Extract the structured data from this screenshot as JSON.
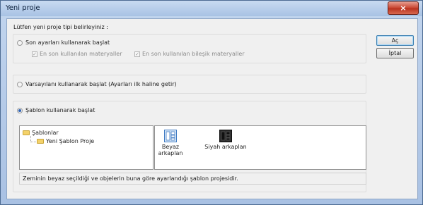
{
  "window": {
    "title": "Yeni proje",
    "close_glyph": "×"
  },
  "prompt": "Lütfen yeni proje tipi belirleyiniz :",
  "option_last": {
    "label": "Son ayarları kullanarak başlat",
    "selected": false,
    "checks": [
      {
        "label": "En son kullanılan materyaller",
        "checked": true,
        "disabled": true
      },
      {
        "label": "En son kullanılan bileşik materyaller",
        "checked": true,
        "disabled": true
      }
    ]
  },
  "option_default": {
    "label": "Varsayılanı kullanarak başlat (Ayarları ilk haline getir)",
    "selected": false
  },
  "option_template": {
    "label": "Şablon kullanarak başlat",
    "selected": true,
    "tree": {
      "root": "Şablonlar",
      "child": "Yeni Şablon Proje",
      "icon": "folder-icon"
    },
    "templates": [
      {
        "label_line1": "Beyaz",
        "label_line2": "arkaplan",
        "icon": "white-background-icon",
        "selected": true
      },
      {
        "label_line1": "Siyah arkaplan",
        "label_line2": "",
        "icon": "black-background-icon",
        "selected": false
      }
    ],
    "description": "Zeminin beyaz seçildiği ve objelerin buna göre ayarlandığı şablon projesidir."
  },
  "buttons": {
    "ok": "Aç",
    "cancel": "İptal"
  }
}
